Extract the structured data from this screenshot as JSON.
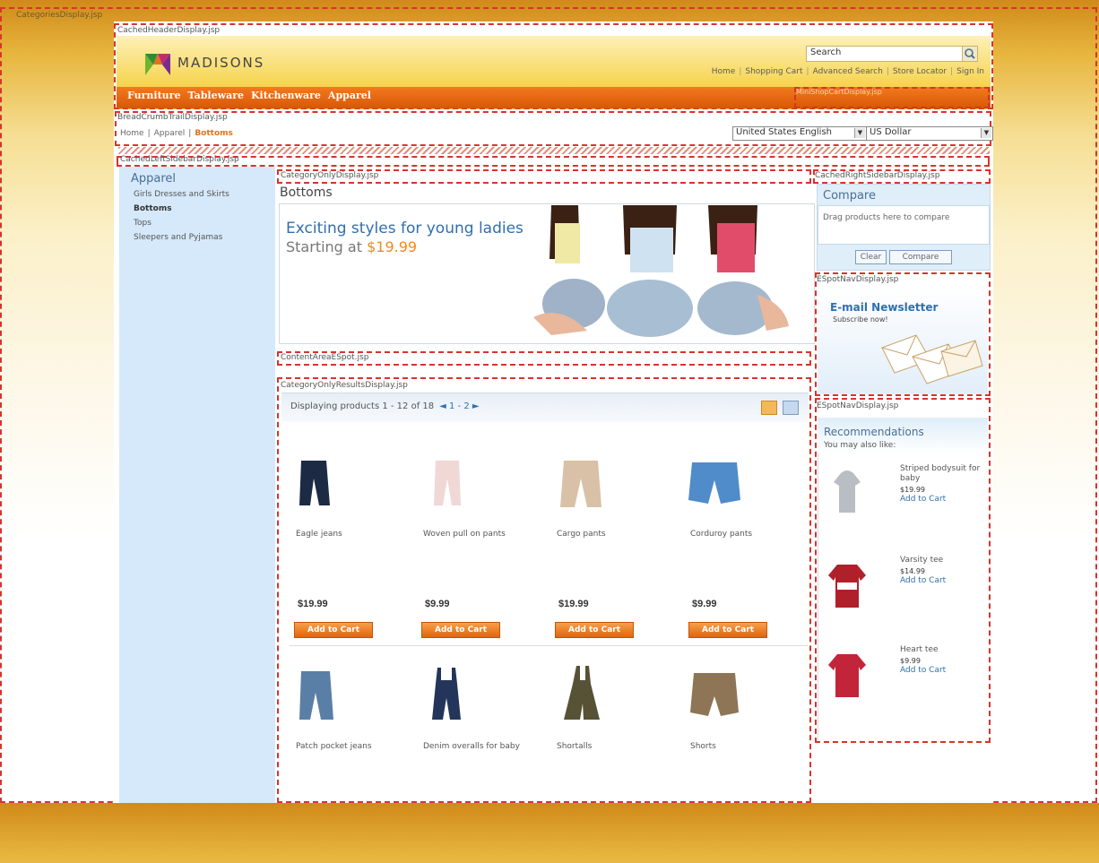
{
  "frames": {
    "categories": "CategoriesDisplay.jsp",
    "header": "CachedHeaderDisplay.jsp",
    "minicart": "MiniShopCartDisplay.jsp",
    "breadcrumb": "BreadCrumbTrailDisplay.jsp",
    "left_sidebar": "CachedLeftSidebarDisplay.jsp",
    "category_only": "CategoryOnlyDisplay.jsp",
    "content_espot": "ContentAreaESpot.jsp",
    "results": "CategoryOnlyResultsDisplay.jsp",
    "right_sidebar": "CachedRightSidebarDisplay.jsp",
    "espot_nav_1": "ESpotNavDisplay.jsp",
    "espot_nav_2": "ESpotNavDisplay.jsp"
  },
  "header": {
    "logo_text": "MADISONS",
    "search_placeholder": "Search",
    "links": [
      "Home",
      "Shopping Cart",
      "Advanced Search",
      "Store Locator",
      "Sign In"
    ],
    "nav": [
      "Furniture",
      "Tableware",
      "Kitchenware",
      "Apparel"
    ]
  },
  "breadcrumb": {
    "items": [
      "Home",
      "Apparel"
    ],
    "current": "Bottoms",
    "language": "United States English",
    "currency": "US Dollar"
  },
  "left_sidebar": {
    "title": "Apparel",
    "items": [
      "Girls Dresses and Skirts",
      "Bottoms",
      "Tops",
      "Sleepers and Pyjamas"
    ],
    "active_index": 1
  },
  "category": {
    "title": "Bottoms",
    "banner_line1": "Exciting styles for young ladies",
    "banner_line2": "Starting at",
    "banner_price": "$19.99"
  },
  "results": {
    "count_text": "Displaying products 1 - 12 of 18",
    "pages_text": "◄ 1 - 2 ►",
    "products": [
      {
        "name": "Eagle jeans",
        "price": "$19.99",
        "button": "Add to Cart",
        "color": "#1c2a44"
      },
      {
        "name": "Woven pull on pants",
        "price": "$9.99",
        "button": "Add to Cart",
        "color": "#efd8d6"
      },
      {
        "name": "Cargo pants",
        "price": "$19.99",
        "button": "Add to Cart",
        "color": "#d8c1a6"
      },
      {
        "name": "Corduroy pants",
        "price": "$9.99",
        "button": "Add to Cart",
        "color": "#4f8cc9"
      },
      {
        "name": "Patch pocket jeans",
        "price": "",
        "button": "",
        "color": "#5a7fa6"
      },
      {
        "name": "Denim overalls for baby",
        "price": "",
        "button": "",
        "color": "#23355a"
      },
      {
        "name": "Shortalls",
        "price": "",
        "button": "",
        "color": "#575136"
      },
      {
        "name": "Shorts",
        "price": "",
        "button": "",
        "color": "#8e7556"
      }
    ]
  },
  "compare": {
    "title": "Compare",
    "text": "Drag products here to compare",
    "clear": "Clear",
    "compare": "Compare"
  },
  "newsletter": {
    "title": "E-mail Newsletter",
    "subtitle": "Subscribe now!"
  },
  "recommendations": {
    "title": "Recommendations",
    "subtitle": "You may also like:",
    "items": [
      {
        "name": "Striped bodysuit for baby",
        "price": "$19.99",
        "add": "Add to Cart",
        "color": "#b9bec4"
      },
      {
        "name": "Varsity tee",
        "price": "$14.99",
        "add": "Add to Cart",
        "color": "#b0202b"
      },
      {
        "name": "Heart tee",
        "price": "$9.99",
        "add": "Add to Cart",
        "color": "#c2253a"
      }
    ]
  }
}
